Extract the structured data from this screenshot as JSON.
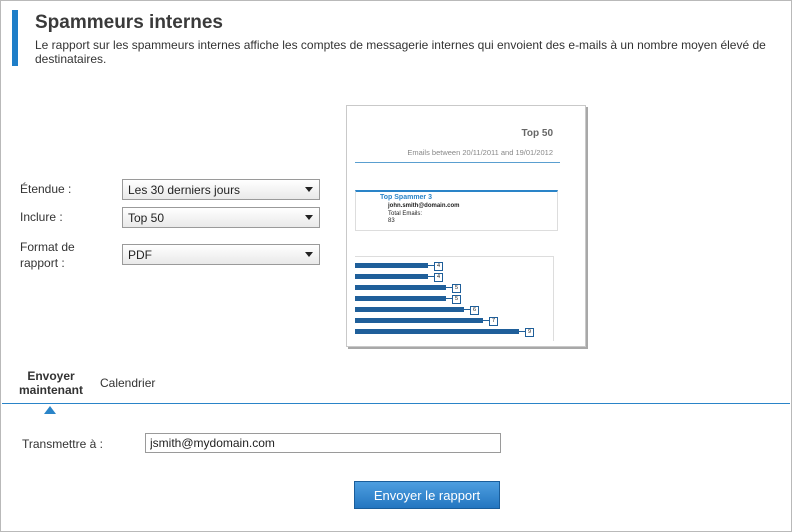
{
  "header": {
    "title": "Spammeurs internes",
    "description": "Le rapport sur les spammeurs internes affiche les comptes de messagerie internes qui envoient des e-mails à un nombre moyen élevé de destinataires."
  },
  "form": {
    "scope_label": "Étendue :",
    "scope_value": "Les 30 derniers jours",
    "include_label": "Inclure :",
    "include_value": "Top 50",
    "format_label_line1": "Format de",
    "format_label_line2": "rapport :",
    "format_value": "PDF"
  },
  "preview": {
    "title": "Top 50",
    "subtitle": "Emails between 20/11/2011 and 19/01/2012",
    "top_spammer_title": "Top Spammer 3",
    "top_spammer_email": "john.smith@domain.com",
    "total_emails_label": "Total Emails:",
    "total_emails_value": "83",
    "bar_values": [
      4,
      4,
      5,
      5,
      6,
      7,
      9
    ],
    "bar_labels": [
      "4",
      "4",
      "5",
      "5",
      "6",
      "7",
      "9"
    ]
  },
  "tabs": {
    "send_now_line1": "Envoyer",
    "send_now_line2": "maintenant",
    "calendar": "Calendrier"
  },
  "send": {
    "forward_label": "Transmettre à :",
    "email_value": "jsmith@mydomain.com",
    "button_label": "Envoyer le rapport"
  },
  "colors": {
    "accent": "#1e7ec8",
    "button": "#2e84cc",
    "bar": "#1f5f9a"
  }
}
